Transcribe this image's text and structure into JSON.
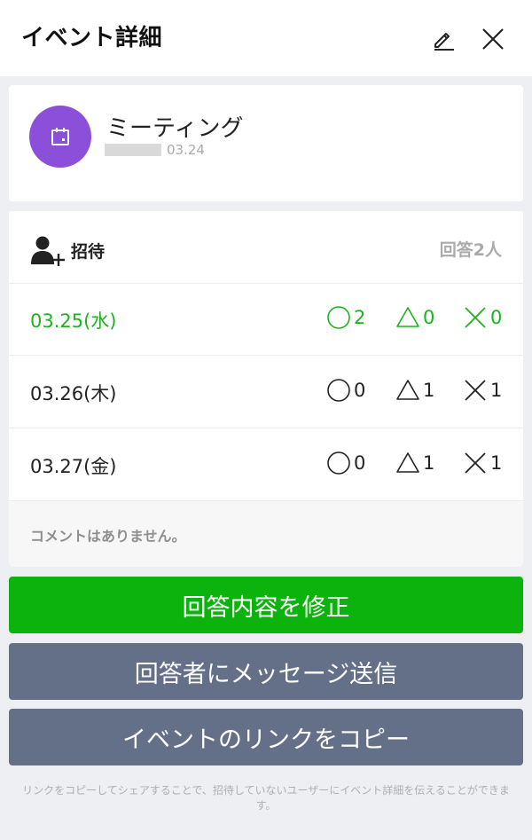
{
  "header": {
    "title": "イベント詳細",
    "edit_icon": "pencil-icon",
    "close_icon": "close-icon"
  },
  "event": {
    "icon": "calendar-icon",
    "avatar_color": "#8b4fd9",
    "title": "ミーティング",
    "date": "03.24"
  },
  "invite": {
    "icon": "add-user-icon",
    "label": "招待",
    "response_count": "回答2人",
    "dates": [
      {
        "label": "03.25(水)",
        "ok": "2",
        "maybe": "0",
        "no": "0",
        "highlighted": true
      },
      {
        "label": "03.26(木)",
        "ok": "0",
        "maybe": "1",
        "no": "1",
        "highlighted": false
      },
      {
        "label": "03.27(金)",
        "ok": "0",
        "maybe": "1",
        "no": "1",
        "highlighted": false
      }
    ],
    "no_comments": "コメントはありません。"
  },
  "actions": {
    "edit_answer": "回答内容を修正",
    "message_respondents": "回答者にメッセージ送信",
    "copy_link": "イベントのリンクをコピー"
  },
  "note": "リンクをコピーしてシェアすることで、招待していないユーザーにイベント詳細を伝えることができます。",
  "colors": {
    "accent_green": "#0cb30c",
    "button_slate": "#646f88",
    "background": "#eeeff2"
  }
}
